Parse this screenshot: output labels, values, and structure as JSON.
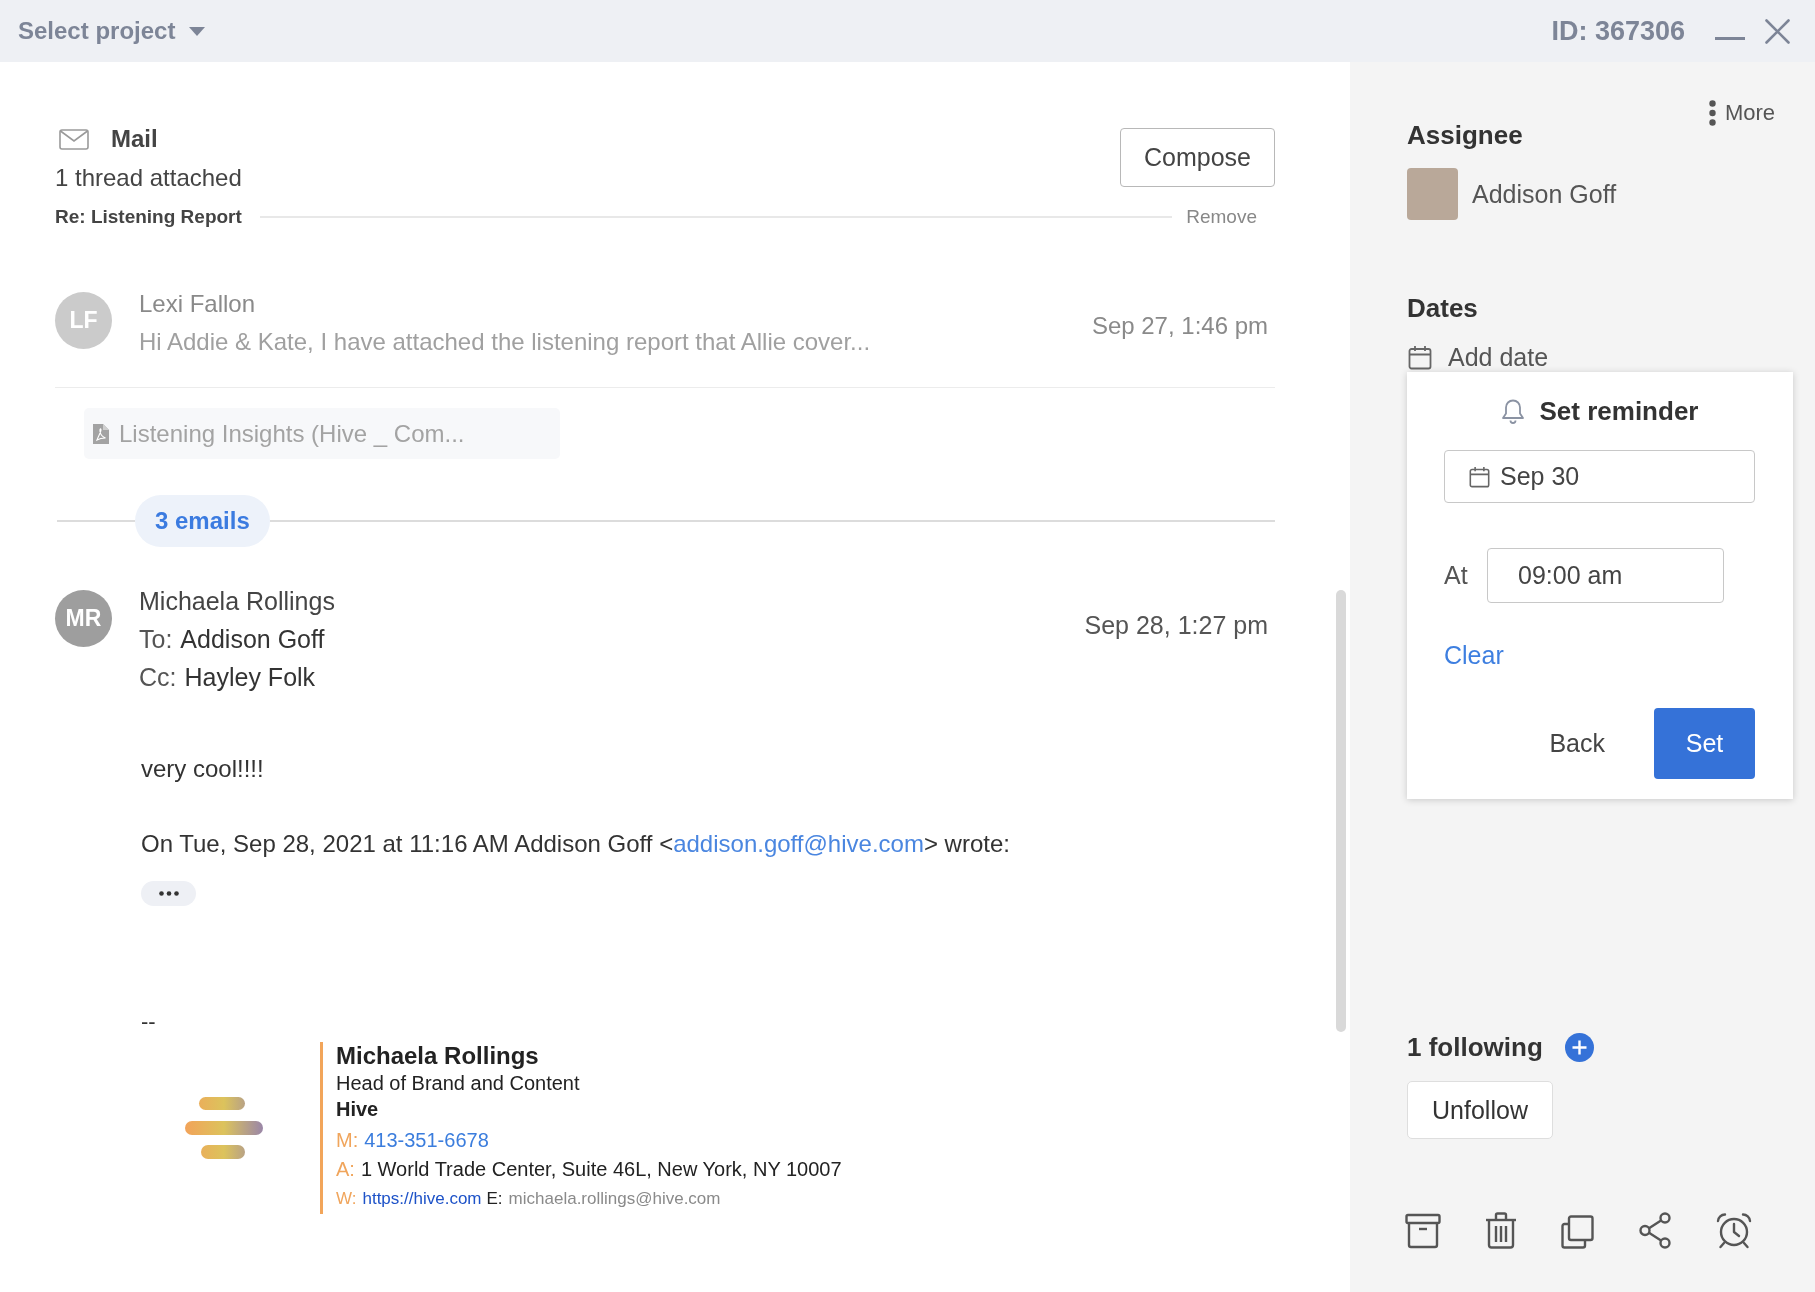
{
  "title_bar": {
    "project_selector": "Select project",
    "record_id": "ID: 367306"
  },
  "mail": {
    "title": "Mail",
    "thread_summary": "1 thread attached",
    "thread_subject": "Re: Listening Report",
    "remove": "Remove",
    "compose": "Compose"
  },
  "earlier_email": {
    "initials": "LF",
    "sender": "Lexi Fallon",
    "preview": "Hi Addie & Kate, I have attached the listening report that Allie cover...",
    "date": "Sep 27, 1:46 pm",
    "attachment": "Listening Insights (Hive _ Com..."
  },
  "thread_count": "3 emails",
  "latest_email": {
    "initials": "MR",
    "sender": "Michaela Rollings",
    "to_label": "To:",
    "to": "Addison Goff",
    "cc_label": "Cc:",
    "cc": "Hayley Folk",
    "date": "Sep 28, 1:27 pm",
    "body": "very cool!!!!",
    "quote_header": {
      "before": "On Tue, Sep 28, 2021 at 11:16 AM Addison Goff <",
      "link": "addison.goff@hive.com",
      "after": "> wrote:"
    },
    "signature_separator": "--",
    "signature": {
      "name": "Michaela Rollings",
      "job_title": "Head of Brand and Content",
      "company": "Hive",
      "mobile_label": "M:",
      "mobile": "413-351-6678",
      "address_label": "A:",
      "address": "1 World Trade Center, Suite 46L, New York, NY 10007",
      "web_label": "W:",
      "web": "https://hive.com",
      "email_label": "E:",
      "email": "michaela.rollings@hive.com"
    }
  },
  "side_panel": {
    "more": "More",
    "assignee": {
      "heading": "Assignee",
      "name": "Addison Goff"
    },
    "dates": {
      "heading": "Dates",
      "add_date": "Add date"
    },
    "reminder": {
      "title": "Set reminder",
      "date": "Sep 30",
      "at_label": "At",
      "time": "09:00 am",
      "clear": "Clear",
      "back": "Back",
      "set": "Set"
    },
    "following": {
      "label": "1 following",
      "unfollow": "Unfollow"
    }
  }
}
